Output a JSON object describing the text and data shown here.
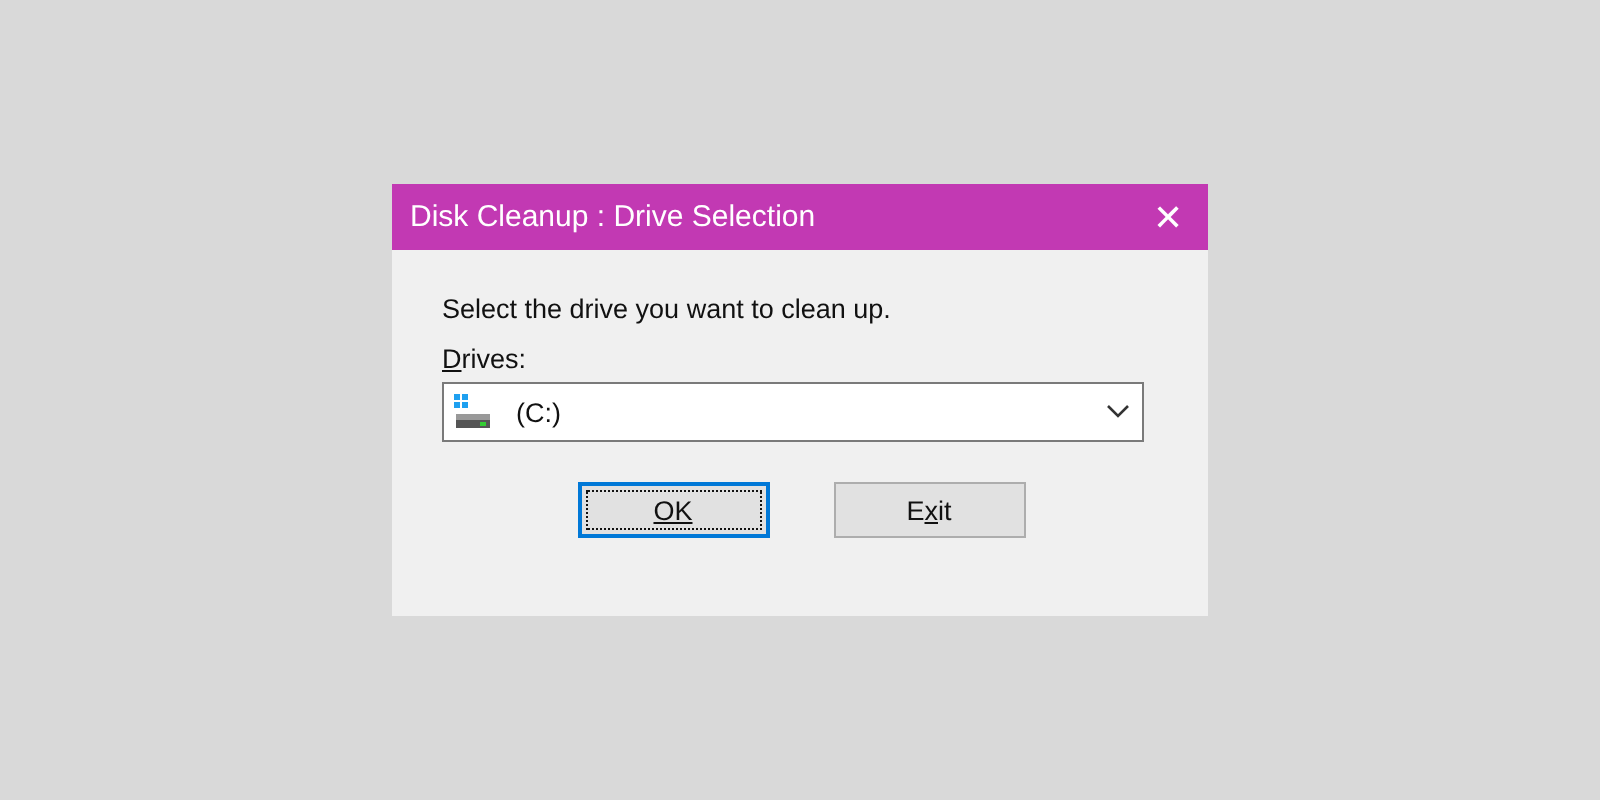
{
  "window": {
    "title": "Disk Cleanup : Drive Selection",
    "close_glyph": "✕"
  },
  "prompt": "Select the drive you want to clean up.",
  "drives": {
    "label": {
      "key": "D",
      "after": "rives:"
    },
    "value": "(C:)",
    "expanded": false
  },
  "buttons": [
    {
      "label": {
        "key": "OK"
      },
      "focused": true
    },
    {
      "label": {
        "before": "E",
        "key": "x",
        "after": "it"
      },
      "focused": false
    }
  ]
}
